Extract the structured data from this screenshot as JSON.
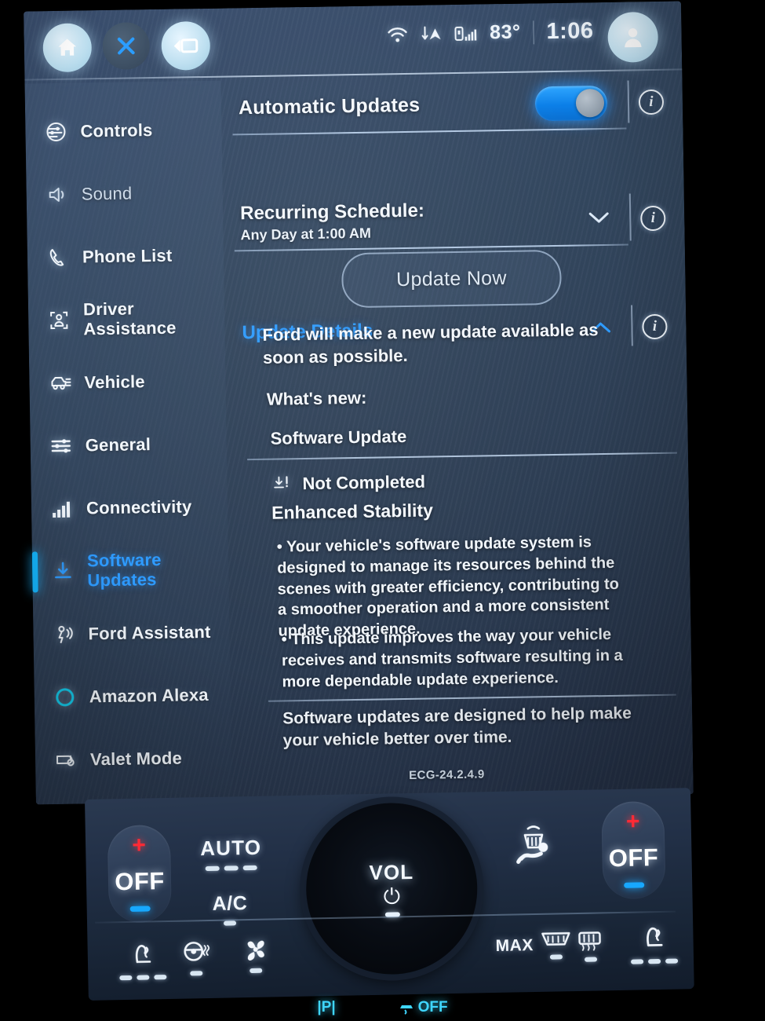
{
  "statusbar": {
    "home_icon": "home-icon",
    "close_icon": "close-icon",
    "media_icon": "media-screen-icon",
    "wifi_icon": "wifi-icon",
    "data_icon": "data-transfer-icon",
    "signal_icon": "cellular-signal-icon",
    "temperature": "83°",
    "clock": "1:06",
    "avatar_icon": "user-profile-icon"
  },
  "sidebar": {
    "items": [
      {
        "label": "Controls",
        "icon": "controls-sliders-icon",
        "state": "normal"
      },
      {
        "label": "Sound",
        "icon": "speaker-icon",
        "state": "dim"
      },
      {
        "label": "Phone List",
        "icon": "phone-icon",
        "state": "normal"
      },
      {
        "label": "Driver Assistance",
        "icon": "driver-assistance-icon",
        "state": "normal"
      },
      {
        "label": "Vehicle",
        "icon": "vehicle-icon",
        "state": "normal"
      },
      {
        "label": "General",
        "icon": "general-sliders-icon",
        "state": "normal"
      },
      {
        "label": "Connectivity",
        "icon": "signal-bars-icon",
        "state": "normal"
      },
      {
        "label": "Software Updates",
        "icon": "download-icon",
        "state": "active"
      },
      {
        "label": "Ford Assistant",
        "icon": "ford-assistant-icon",
        "state": "normal"
      },
      {
        "label": "Amazon Alexa",
        "icon": "amazon-alexa-icon",
        "state": "normal"
      },
      {
        "label": "Valet Mode",
        "icon": "valet-key-icon",
        "state": "normal"
      }
    ]
  },
  "content": {
    "automatic_updates_label": "Automatic Updates",
    "automatic_updates_toggle": "on",
    "recurring_schedule_label": "Recurring Schedule:",
    "recurring_schedule_value": "Any Day at 1:00 AM",
    "update_details_label": "Update Details",
    "update_details_expanded": "expanded",
    "update_now_label": "Update Now",
    "intro_text": "Ford will make a new update available as soon as possible.",
    "whats_new_label": "What's new:",
    "update_name": "Software Update",
    "status_label": "Not Completed",
    "status_icon": "download-alert-icon",
    "feature_title": "Enhanced Stability",
    "bullets": [
      "• Your vehicle's software update system is designed to manage its resources behind the scenes with greater efficiency, contributing to a smoother operation and a more consistent update experience.",
      "• This update improves the way your vehicle receives and transmits software resulting in a more dependable update experience."
    ],
    "footer_note": "Software updates are designed to help make your vehicle better over time.",
    "version": "ECG-24.2.4.9",
    "info_icon": "info-icon",
    "chevron_down_icon": "chevron-down-icon",
    "chevron_up_icon": "chevron-up-icon"
  },
  "climate": {
    "left_temp": {
      "plus": "+",
      "value": "OFF",
      "minus": "−"
    },
    "right_temp": {
      "plus": "+",
      "value": "OFF",
      "minus": "−"
    },
    "auto_label": "AUTO",
    "ac_label": "A/C",
    "volume_label": "VOL",
    "power_icon": "power-icon",
    "front_defrost_icon": "front-defrost-icon",
    "rear_defrost_icon": "rear-defrost-icon",
    "max_label": "MAX",
    "max_defrost_icon": "max-defrost-icon",
    "heated_seat_icon": "heated-seat-icon",
    "heated_wheel_icon": "heated-steering-wheel-icon",
    "fan_icon": "fan-icon"
  },
  "indicators": {
    "park": "|P|",
    "traction_off": "OFF",
    "traction_icon": "traction-control-off-icon"
  },
  "colors": {
    "accent_blue": "#2e9bff",
    "indicator_cyan": "#15b7ff",
    "toggle_blue": "#0b7fe8",
    "warm_red": "#ff2a35",
    "screen_bg": "#33475f"
  }
}
